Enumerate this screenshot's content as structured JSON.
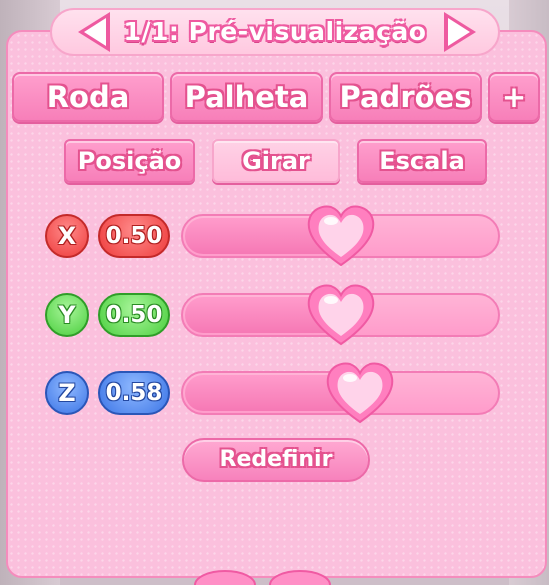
{
  "header": {
    "title": "1/1: Pré-visualização"
  },
  "tabs": [
    {
      "label": "Roda"
    },
    {
      "label": "Palheta"
    },
    {
      "label": "Padrões"
    },
    {
      "label": "+"
    }
  ],
  "subtabs": [
    {
      "label": "Posição",
      "active": false
    },
    {
      "label": "Girar",
      "active": true
    },
    {
      "label": "Escala",
      "active": false
    }
  ],
  "sliders": [
    {
      "axis": "X",
      "value_text": "0.50",
      "value": 0.5,
      "color": "#ee3c3c"
    },
    {
      "axis": "Y",
      "value_text": "0.50",
      "value": 0.5,
      "color": "#4ccf3f"
    },
    {
      "axis": "Z",
      "value_text": "0.58",
      "value": 0.58,
      "color": "#3d76e6"
    }
  ],
  "reset_label": "Redefinir",
  "colors": {
    "panel": "#fbc0dd",
    "accent": "#ee5aa0",
    "handle": "#ff7fbf"
  },
  "icons": {
    "prev": "chevron-left-icon",
    "next": "chevron-right-icon",
    "handle": "heart-icon"
  }
}
